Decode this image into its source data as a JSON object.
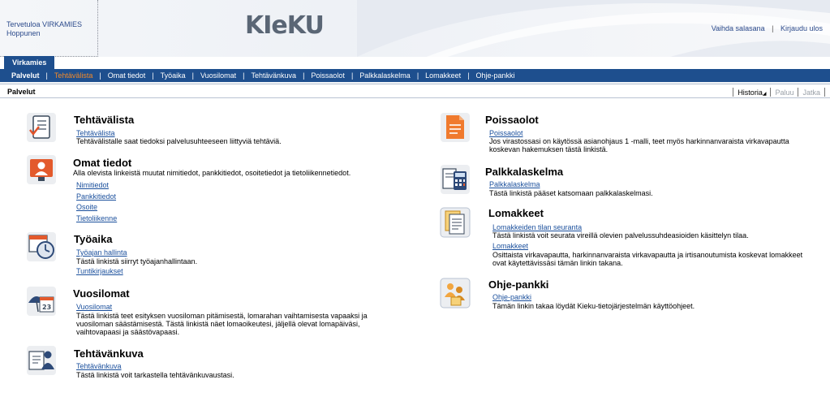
{
  "header": {
    "welcome_line1": "Tervetuloa VIRKAMIES",
    "welcome_line2": "Hoppunen",
    "logo_text": "KIeKU",
    "change_password": "Vaihda salasana",
    "separator": "|",
    "logout": "Kirjaudu ulos"
  },
  "tabs": {
    "main_tab": "Virkamies"
  },
  "nav": {
    "separator": "|",
    "items": [
      "Palvelut",
      "Tehtävälista",
      "Omat tiedot",
      "Työaika",
      "Vuosilomat",
      "Tehtävänkuva",
      "Poissaolot",
      "Palkkalaskelma",
      "Lomakkeet",
      "Ohje-pankki"
    ]
  },
  "toolbar": {
    "title": "Palvelut",
    "history": "Historia",
    "back": "Paluu",
    "forward": "Jatka"
  },
  "sections": {
    "tehtavalista": {
      "title": "Tehtävälista",
      "link": "Tehtävälista",
      "desc": "Tehtävälistalle saat tiedoksi palvelusuhteeseen liittyviä tehtäviä."
    },
    "omat": {
      "title": "Omat tiedot",
      "desc": "Alla olevista linkeistä muutat nimitiedot, pankkitiedot, osoitetiedot ja tietoliikennetiedot.",
      "links": [
        "Nimitiedot",
        "Pankkitiedot",
        "Osoite",
        "Tietoliikenne"
      ]
    },
    "tyoaika": {
      "title": "Työaika",
      "link1": "Työajan hallinta",
      "desc": "Tästä linkistä siirryt työajanhallintaan.",
      "link2": "Tuntikirjaukset"
    },
    "vuosilomat": {
      "title": "Vuosilomat",
      "link": "Vuosilomat",
      "desc_lines": [
        "Tästä linkistä teet esityksen vuosiloman pitämisestä, lomarahan vaihtamisesta vapaaksi ja",
        "vuosiloman säästämisestä. Tästä linkistä näet lomaoikeutesi, jäljellä olevat lomapäiväsi,",
        "vaihtovapaasi ja säästövapaasi."
      ]
    },
    "tehtavankuva": {
      "title": "Tehtävänkuva",
      "link": "Tehtävänkuva",
      "desc": "Tästä linkistä voit tarkastella tehtävänkuvaustasi."
    },
    "poissaolot": {
      "title": "Poissaolot",
      "link": "Poissaolot",
      "desc_lines": [
        "Jos virastossasi on käytössä asianohjaus 1 -malli, teet myös harkinnanvaraista virkavapautta",
        "koskevan hakemuksen tästä linkistä."
      ]
    },
    "palkka": {
      "title": "Palkkalaskelma",
      "link": "Palkkalaskelma",
      "desc": "Tästä linkistä pääset katsomaan palkkalaskelmasi."
    },
    "lomakkeet": {
      "title": "Lomakkeet",
      "link1": "Lomakkeiden tilan seuranta",
      "desc1": "Tästä linkistä voit seurata vireillä olevien palvelussuhdeasioiden käsittelyn tilaa.",
      "link2": "Lomakkeet",
      "desc2_lines": [
        "Osittaista virkavapautta, harkinnanvaraista virkavapautta ja irtisanoutumista koskevat lomakkeet",
        "ovat käytettävissäsi tämän linkin takana."
      ]
    },
    "ohje": {
      "title": "Ohje-pankki",
      "link": "Ohje-pankki",
      "desc": "Tämän linkin takaa löydät Kieku-tietojärjestelmän käyttöohjeet."
    }
  }
}
